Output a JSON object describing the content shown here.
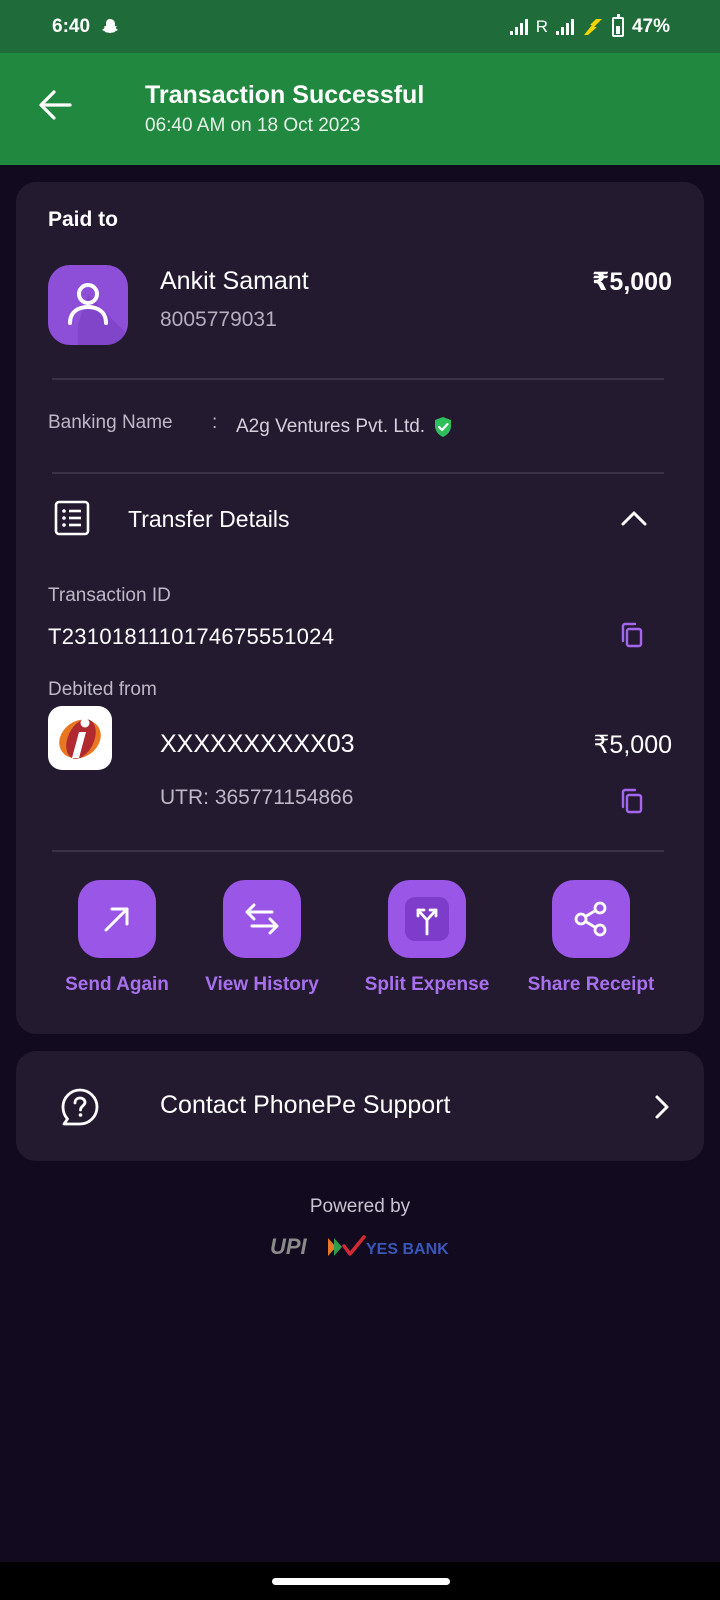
{
  "status_bar": {
    "time": "6:40",
    "roaming": "R",
    "battery": "47%",
    "icons": [
      "snapchat-icon",
      "signal-icon",
      "signal-icon",
      "charging-icon",
      "battery-icon"
    ]
  },
  "header": {
    "title": "Transaction Successful",
    "subtitle": "06:40 AM on 18 Oct 2023",
    "bg_color": "#21893f"
  },
  "payment": {
    "paid_to_label": "Paid to",
    "payee_name": "Ankit Samant",
    "payee_phone": "8005779031",
    "amount": "₹5,000",
    "banking_name_label": "Banking Name",
    "banking_name_colon": ":",
    "banking_name": "A2g Ventures Pvt. Ltd.",
    "verified_color": "#2fbf5a"
  },
  "transfer_details": {
    "title": "Transfer Details",
    "expanded": true,
    "transaction_id_label": "Transaction ID",
    "transaction_id": "T2310181110174675551024",
    "debited_from_label": "Debited from",
    "account_number": "XXXXXXXXXX03",
    "debited_amount": "₹5,000",
    "utr": "UTR: 365771154866"
  },
  "actions": [
    {
      "label": "Send Again",
      "icon": "arrow-up-right-icon"
    },
    {
      "label": "View History",
      "icon": "swap-arrows-icon"
    },
    {
      "label": "Split Expense",
      "icon": "split-icon"
    },
    {
      "label": "Share Receipt",
      "icon": "share-icon"
    }
  ],
  "support": {
    "label": "Contact PhonePe Support"
  },
  "footer": {
    "powered_by": "Powered by",
    "logos": [
      "UPI",
      "YES BANK"
    ]
  },
  "theme": {
    "accent": "#9a56e6",
    "card_bg": "#231a30",
    "page_bg": "#120a1f"
  }
}
